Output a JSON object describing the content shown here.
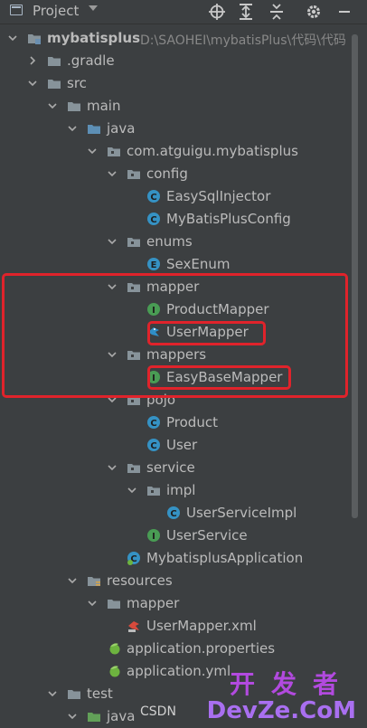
{
  "header": {
    "title": "Project",
    "icons": [
      "project-icon",
      "dropdown-caret-icon",
      "target-icon",
      "expand-all-icon",
      "collapse-all-icon",
      "gear-icon",
      "minimize-icon"
    ]
  },
  "tree": [
    {
      "label": "mybatisplus",
      "suffix": "D:\\SAOHEI\\mybatisPlus\\代码\\代码",
      "icon": "module-folder-icon",
      "expanded": true
    },
    {
      "label": ".gradle",
      "icon": "folder-icon",
      "expanded": false
    },
    {
      "label": "src",
      "icon": "folder-icon",
      "expanded": true
    },
    {
      "label": "main",
      "icon": "folder-icon",
      "expanded": true
    },
    {
      "label": "java",
      "icon": "source-folder-icon",
      "expanded": true
    },
    {
      "label": "com.atguigu.mybatisplus",
      "icon": "package-icon",
      "expanded": true
    },
    {
      "label": "config",
      "icon": "package-icon",
      "expanded": true
    },
    {
      "label": "EasySqlInjector",
      "icon": "class-icon"
    },
    {
      "label": "MyBatisPlusConfig",
      "icon": "class-icon"
    },
    {
      "label": "enums",
      "icon": "package-icon",
      "expanded": true
    },
    {
      "label": "SexEnum",
      "icon": "enum-icon"
    },
    {
      "label": "mapper",
      "icon": "package-icon",
      "expanded": true
    },
    {
      "label": "ProductMapper",
      "icon": "interface-icon"
    },
    {
      "label": "UserMapper",
      "icon": "mybatis-bird-icon"
    },
    {
      "label": "mappers",
      "icon": "package-icon",
      "expanded": true
    },
    {
      "label": "EasyBaseMapper",
      "icon": "interface-icon"
    },
    {
      "label": "pojo",
      "icon": "package-icon",
      "expanded": true
    },
    {
      "label": "Product",
      "icon": "class-icon"
    },
    {
      "label": "User",
      "icon": "class-icon"
    },
    {
      "label": "service",
      "icon": "package-icon",
      "expanded": true
    },
    {
      "label": "impl",
      "icon": "package-icon",
      "expanded": true
    },
    {
      "label": "UserServiceImpl",
      "icon": "class-icon"
    },
    {
      "label": "UserService",
      "icon": "interface-icon"
    },
    {
      "label": "MybatisplusApplication",
      "icon": "spring-boot-class-icon"
    },
    {
      "label": "resources",
      "icon": "resources-folder-icon",
      "expanded": true
    },
    {
      "label": "mapper",
      "icon": "folder-icon",
      "expanded": true
    },
    {
      "label": "UserMapper.xml",
      "icon": "mybatis-xml-icon"
    },
    {
      "label": "application.properties",
      "icon": "spring-properties-icon"
    },
    {
      "label": "application.yml",
      "icon": "spring-yml-icon"
    },
    {
      "label": "test",
      "icon": "folder-icon",
      "expanded": true
    },
    {
      "label": "java",
      "icon": "test-folder-icon",
      "expanded": true
    }
  ],
  "watermark": {
    "csdn": "CSDN",
    "cn": "开发者",
    "site": "DevZe.CoM"
  },
  "colors": {
    "background": "#3c3f41",
    "text": "#bbbbbb",
    "folder": "#87939a",
    "source_folder": "#5d8fb5",
    "class": "#3592c4",
    "interface": "#499c54",
    "highlight": "#e0232b"
  }
}
